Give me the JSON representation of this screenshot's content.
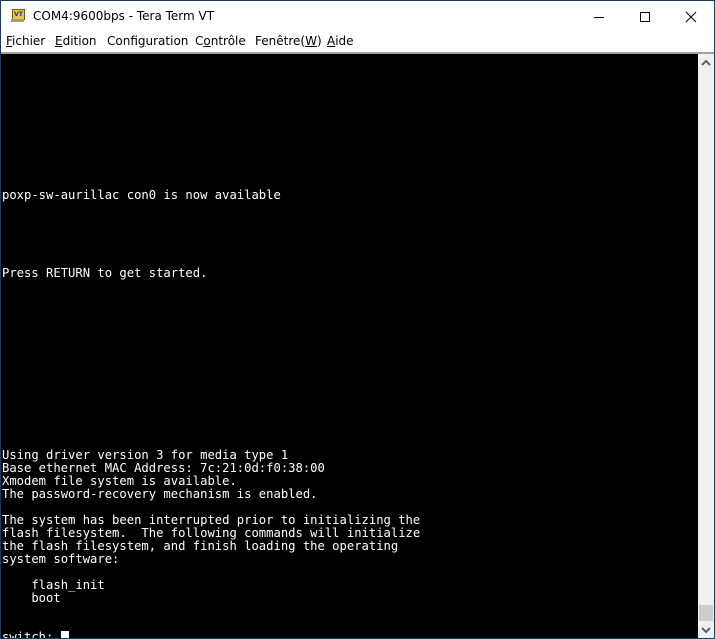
{
  "window": {
    "title": "COM4:9600bps - Tera Term VT",
    "icon": "tera-term-vt-icon",
    "controls": [
      "minimize",
      "maximize",
      "close"
    ]
  },
  "menu": [
    {
      "pre": "",
      "accel": "F",
      "post": "ichier"
    },
    {
      "pre": "",
      "accel": "E",
      "post": "dition"
    },
    {
      "pre": "Confi",
      "accel": "g",
      "post": "uration"
    },
    {
      "pre": "C",
      "accel": "o",
      "post": "ntrôle"
    },
    {
      "pre": "Fenêtre(",
      "accel": "W",
      "post": ")"
    },
    {
      "pre": "",
      "accel": "A",
      "post": "ide"
    }
  ],
  "terminal": {
    "lines": [
      {
        "row": 10,
        "text": "poxp-sw-aurillac con0 is now available"
      },
      {
        "row": 16,
        "text": "Press RETURN to get started."
      },
      {
        "row": 30,
        "text": "Using driver version 3 for media type 1"
      },
      {
        "row": 31,
        "text": "Base ethernet MAC Address: 7c:21:0d:f0:38:00"
      },
      {
        "row": 32,
        "text": "Xmodem file system is available."
      },
      {
        "row": 33,
        "text": "The password-recovery mechanism is enabled."
      },
      {
        "row": 35,
        "text": "The system has been interrupted prior to initializing the"
      },
      {
        "row": 36,
        "text": "flash filesystem.  The following commands will initialize"
      },
      {
        "row": 37,
        "text": "the flash filesystem, and finish loading the operating"
      },
      {
        "row": 38,
        "text": "system software:"
      },
      {
        "row": 40,
        "text": "    flash_init"
      },
      {
        "row": 41,
        "text": "    boot"
      }
    ],
    "prompt": "switch: ",
    "foreground": "#ffffff",
    "background": "#000000"
  },
  "scrollbar": {
    "position_fraction": 1.0
  }
}
